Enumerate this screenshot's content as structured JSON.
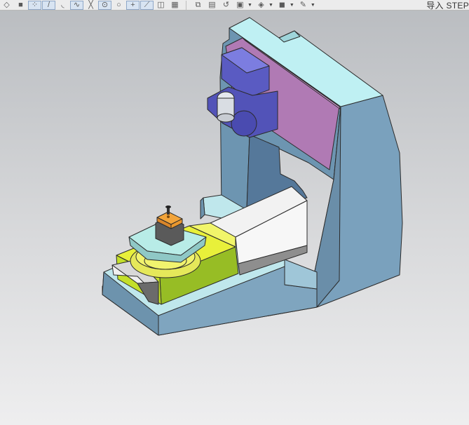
{
  "toolbar": {
    "buttons": [
      {
        "icon": "view-cube-icon",
        "glyph": "◇",
        "active": false
      },
      {
        "icon": "shaded-cube-icon",
        "glyph": "■",
        "active": false
      },
      {
        "icon": "snap-points-icon",
        "glyph": "⁘",
        "active": true
      },
      {
        "icon": "line-icon",
        "glyph": "/",
        "active": true
      },
      {
        "icon": "arc-icon",
        "glyph": "◟",
        "active": false
      },
      {
        "icon": "spline-icon",
        "glyph": "∿",
        "active": true
      },
      {
        "icon": "axis-icon",
        "glyph": "╳",
        "active": false
      },
      {
        "icon": "center-point-icon",
        "glyph": "⊙",
        "active": true
      },
      {
        "icon": "circle-point-icon",
        "glyph": "○",
        "active": false
      },
      {
        "icon": "cross-point-icon",
        "glyph": "+",
        "active": true
      },
      {
        "icon": "edit-curve-icon",
        "glyph": "⟋",
        "active": true
      },
      {
        "icon": "eraser-icon",
        "glyph": "◫",
        "active": false
      },
      {
        "icon": "grid-icon",
        "glyph": "▦",
        "active": false
      }
    ],
    "buttons2": [
      {
        "icon": "measure-icon",
        "glyph": "⧉",
        "drop": false
      },
      {
        "icon": "notes-icon",
        "glyph": "▤",
        "drop": false
      },
      {
        "icon": "undo-rotate-icon",
        "glyph": "↺",
        "drop": false
      },
      {
        "icon": "table-icon",
        "glyph": "▣",
        "drop": true
      },
      {
        "icon": "layers-icon",
        "glyph": "◈",
        "drop": true
      },
      {
        "icon": "solid-icon",
        "glyph": "◼",
        "drop": true
      },
      {
        "icon": "paint-icon",
        "glyph": "✎",
        "drop": true
      }
    ],
    "import_label": "导入 STEP"
  },
  "colors": {
    "base": "#6d93ad",
    "base_top": "#bfe7ec",
    "column_side": "#6d95b1",
    "column_front": "#7fa6c1",
    "column_top": "#bfeff3",
    "pink_plate": "#b07ab4",
    "spindle": "#5a5bc2",
    "yellow": "#e7ef3a",
    "green": "#95bb24",
    "rail_white": "#f1f1f1",
    "rail_gray": "#8f8f8f",
    "table_top": "#b9ebe7",
    "gray_block": "#5a5a5a",
    "orange": "#f2a43a"
  }
}
